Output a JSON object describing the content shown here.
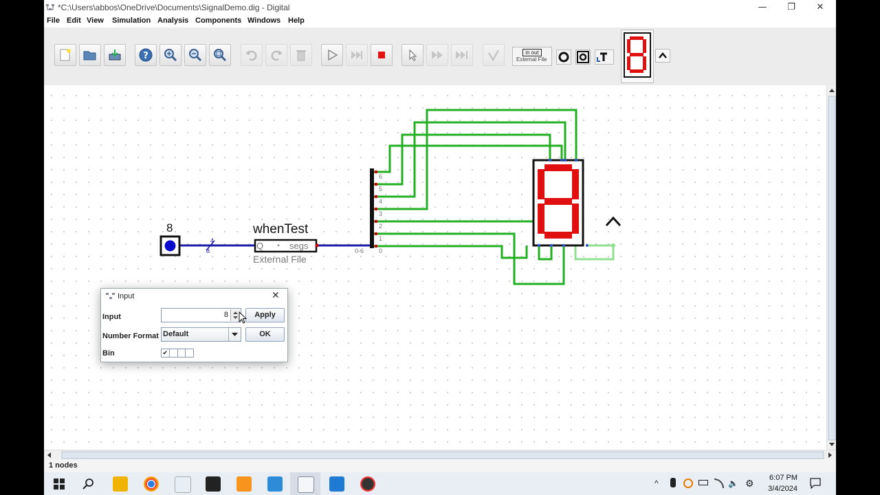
{
  "window": {
    "title": "*C:\\Users\\abbos\\OneDrive\\Documents\\SignalDemo.dig - Digital",
    "controls": {
      "minimize": "—",
      "maximize": "❐",
      "close": "✕"
    }
  },
  "menu": [
    "File",
    "Edit",
    "View",
    "Simulation",
    "Analysis",
    "Components",
    "Windows",
    "Help"
  ],
  "toolbar": {
    "buttons": [
      "new-file",
      "open-file",
      "save",
      "help",
      "zoom-in",
      "zoom-out",
      "fit-zoom",
      "undo",
      "redo",
      "delete",
      "run-simulation",
      "step",
      "stop-simulation",
      "select",
      "fast-forward",
      "skip",
      "analysis"
    ],
    "external_file_small": {
      "top": "in out",
      "bottom": "External File"
    }
  },
  "circuit": {
    "input_value": "8",
    "wire_bits_top": "4",
    "wire_bits_bottom": "8",
    "component_name": "whenTest",
    "component_in": "Q",
    "component_out": "segs",
    "component_type": "External File",
    "splitter_in_label": "0-6",
    "splitter_outputs": [
      "6",
      "5",
      "4",
      "3",
      "2",
      "1",
      "0"
    ]
  },
  "dialog": {
    "title": "Input",
    "input_label": "Input",
    "input_value": "8",
    "apply_label": "Apply",
    "format_label": "Number Format",
    "format_value": "Default",
    "ok_label": "OK",
    "bin_label": "Bin",
    "bin_check": "✔"
  },
  "status": "1 nodes",
  "taskbar": {
    "time": "6:07 PM",
    "date": "3/4/2024"
  },
  "colors": {
    "wire_green": "#22b022",
    "wire_blue": "#1a1aa8",
    "segment_red": "#e01010",
    "accent": "#0f6cbd"
  }
}
